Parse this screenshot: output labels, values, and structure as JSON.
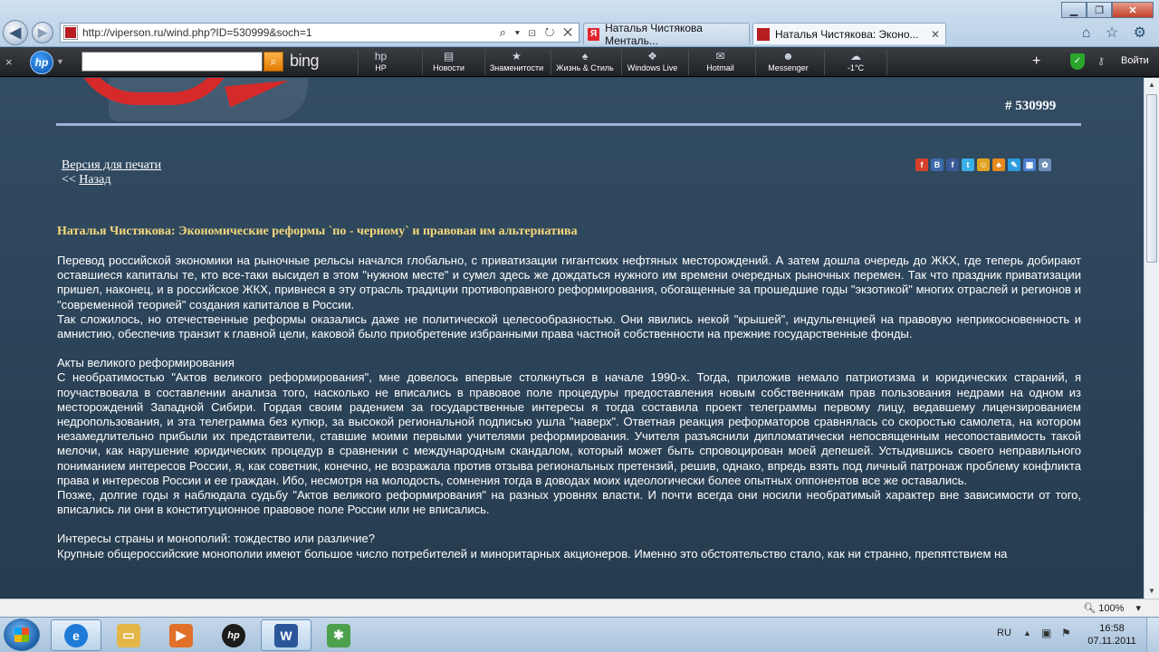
{
  "browser": {
    "url": "http://viperson.ru/wind.php?ID=530999&soch=1",
    "address_icons": "⌕ ▾ ⊡ ↻ ✕",
    "tabs": [
      {
        "label": "Наталья Чистякова Менталь...",
        "favicon_letter": "Я",
        "active": false
      },
      {
        "label": "Наталья Чистякова: Эконо...",
        "active": true
      }
    ],
    "tab_close": "✕",
    "window_controls": {
      "minimize": "▁",
      "maximize": "❐",
      "close": "✕"
    },
    "right_icons": "⌂ ☆ ⚙"
  },
  "toolbar": {
    "close": "×",
    "hp_logo": "hp",
    "search_placeholder": "",
    "search_button": "⌕",
    "bing": "bing",
    "items": [
      {
        "label": "HP",
        "icon": "hp"
      },
      {
        "label": "Новости",
        "icon": "▤"
      },
      {
        "label": "Знаменитости",
        "icon": "★"
      },
      {
        "label": "Жизнь & Стиль",
        "icon": "♠"
      },
      {
        "label": "Windows Live",
        "icon": "❖"
      },
      {
        "label": "Hotmail",
        "icon": "✉"
      },
      {
        "label": "Messenger",
        "icon": "☻"
      },
      {
        "label": "-1°C",
        "icon": "☁"
      }
    ],
    "plus": "+",
    "login": "Войти",
    "key_icon": "⚷",
    "shield": "✓"
  },
  "page": {
    "doc_id": "# 530999",
    "print_version": "Версия для печати",
    "back_prefix": "<< ",
    "back_link": "Назад",
    "share_icons": [
      {
        "name": "share-icon-1",
        "color": "#d6402b",
        "glyph": "f"
      },
      {
        "name": "vkontakte-icon",
        "color": "#3d6aa8",
        "glyph": "B"
      },
      {
        "name": "facebook-icon",
        "color": "#3b5998",
        "glyph": "f"
      },
      {
        "name": "twitter-icon",
        "color": "#3aaee6",
        "glyph": "t"
      },
      {
        "name": "people-icon",
        "color": "#e0a321",
        "glyph": "☺"
      },
      {
        "name": "network-icon",
        "color": "#e68a1c",
        "glyph": "♣"
      },
      {
        "name": "pencil-icon",
        "color": "#2c9be0",
        "glyph": "✎"
      },
      {
        "name": "bookmark-icon",
        "color": "#4a7fcf",
        "glyph": "▦"
      },
      {
        "name": "settings-icon",
        "color": "#6d8fb5",
        "glyph": "✿"
      }
    ],
    "article_title": "Наталья Чистякова: Экономические реформы `по - черному` и правовая им альтернатива",
    "paragraphs": [
      "Перевод российской экономики на рыночные рельсы начался глобально, с приватизации гигантских нефтяных месторождений. А затем дошла очередь до ЖКХ, где теперь добирают оставшиеся капиталы те, кто все-таки высидел в этом \"нужном месте\" и сумел здесь же дождаться нужного им времени очередных рыночных перемен. Так что праздник приватизации пришел, наконец, и в российское ЖКХ, привнеся в эту отрасль традиции противоправного реформирования, обогащенные за прошедшие годы \"экзотикой\" многих отраслей и регионов и \"современной теорией\" создания капиталов в России.",
      "Так сложилось, но отечественные реформы оказались даже не политической целесообразностью. Они явились некой \"крышей\", индульгенцией на правовую неприкосновенность и амнистию, обеспечив транзит к главной цели, каковой было приобретение избранными права частной собственности на прежние государственные фонды.",
      "",
      "Акты великого реформирования",
      "С необратимостью \"Актов великого реформирования\", мне довелось впервые столкнуться в начале 1990-х. Тогда, приложив немало патриотизма и юридических стараний, я поучаствовала в составлении анализа того, насколько не вписались в правовое поле процедуры предоставления новым собственникам прав пользования недрами на одном из месторождений Западной Сибири. Гордая своим радением за государственные интересы я тогда составила проект телеграммы первому лицу, ведавшему лицензированием недропользования, и эта телеграмма без купюр, за высокой региональной подписью ушла \"наверх\". Ответная реакция реформаторов сравнялась со скоростью самолета, на котором незамедлительно прибыли их представители, ставшие моими первыми учителями реформирования. Учителя разъяснили дипломатически непосвященным несопоставимость такой мелочи, как нарушение юридических процедур в сравнении с международным скандалом, который может быть спровоцирован моей депешей. Устыдившись своего неправильного пониманием интересов России, я, как советник, конечно, не возражала против отзыва региональных претензий, решив, однако, впредь взять под личный патронаж проблему конфликта права и интересов России и ее граждан. Ибо, несмотря на молодость, сомнения тогда в доводах моих идеологически более опытных оппонентов все же оставались.",
      "Позже, долгие годы я наблюдала судьбу \"Актов великого реформирования\" на разных уровнях власти. И почти всегда они носили необратимый характер вне зависимости от того, вписались ли они в конституционное правовое поле России или не вписались.",
      "",
      "Интересы страны и монополий: тождество или различие?",
      "Крупные общероссийские монополии имеют большое число потребителей и миноритарных акционеров. Именно это обстоятельство стало, как ни странно, препятствием на"
    ]
  },
  "statusbar": {
    "zoom": "100%",
    "zoom_caret": "▾"
  },
  "scrollbar": {
    "up": "▲",
    "down": "▼"
  },
  "taskbar": {
    "apps": [
      {
        "name": "ie-taskbar-icon",
        "glyph": "e",
        "color": "#1e7bd8",
        "active": true
      },
      {
        "name": "explorer-taskbar-icon",
        "glyph": "▭",
        "color": "#e4b64a",
        "active": false
      },
      {
        "name": "media-player-taskbar-icon",
        "glyph": "▶",
        "color": "#e0702a",
        "active": false
      },
      {
        "name": "hp-taskbar-icon",
        "glyph": "hp",
        "color": "#1c1c1c",
        "active": false
      },
      {
        "name": "word-taskbar-icon",
        "glyph": "W",
        "color": "#2b579a",
        "active": true
      },
      {
        "name": "network-taskbar-icon",
        "glyph": "✱",
        "color": "#4ca04c",
        "active": false
      }
    ],
    "lang": "RU",
    "tray_up": "▲",
    "net_icon": "▣",
    "flag_icon": "⚑",
    "time": "16:58",
    "date": "07.11.2011"
  }
}
